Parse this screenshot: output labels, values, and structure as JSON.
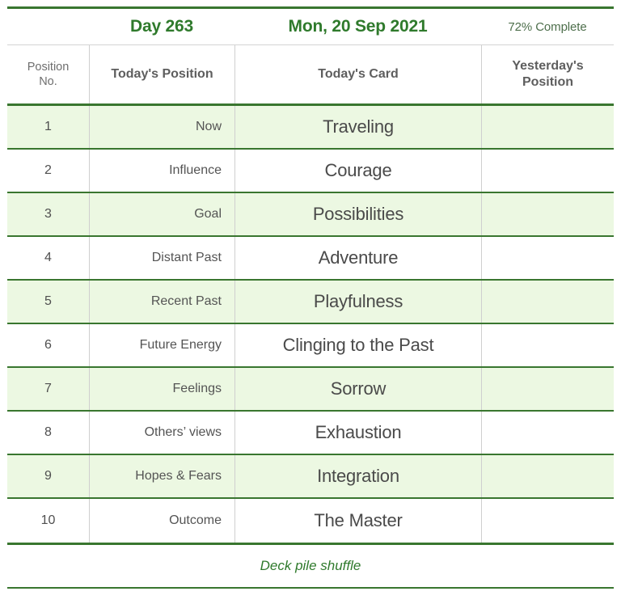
{
  "header": {
    "day_label": "Day 263",
    "date_label": "Mon, 20 Sep 2021",
    "progress_label": "72% Complete",
    "accent_color": "#2f7a2c",
    "rule_color": "#39762f",
    "shade_color": "#ecf8e2"
  },
  "columns": {
    "position_no": "Position\nNo.",
    "position_no_line1": "Position",
    "position_no_line2": "No.",
    "todays_position": "Today's Position",
    "todays_card": "Today's Card",
    "yesterdays_position_line1": "Yesterday's",
    "yesterdays_position_line2": "Position"
  },
  "rows": [
    {
      "no": "1",
      "position": "Now",
      "card": "Traveling",
      "yesterday": ""
    },
    {
      "no": "2",
      "position": "Influence",
      "card": "Courage",
      "yesterday": ""
    },
    {
      "no": "3",
      "position": "Goal",
      "card": "Possibilities",
      "yesterday": ""
    },
    {
      "no": "4",
      "position": "Distant Past",
      "card": "Adventure",
      "yesterday": ""
    },
    {
      "no": "5",
      "position": "Recent Past",
      "card": "Playfulness",
      "yesterday": ""
    },
    {
      "no": "6",
      "position": "Future Energy",
      "card": "Clinging to the Past",
      "yesterday": ""
    },
    {
      "no": "7",
      "position": "Feelings",
      "card": "Sorrow",
      "yesterday": ""
    },
    {
      "no": "8",
      "position": "Others’ views",
      "card": "Exhaustion",
      "yesterday": ""
    },
    {
      "no": "9",
      "position": "Hopes & Fears",
      "card": "Integration",
      "yesterday": ""
    },
    {
      "no": "10",
      "position": "Outcome",
      "card": "The Master",
      "yesterday": ""
    }
  ],
  "footer": {
    "note": "Deck pile shuffle"
  }
}
